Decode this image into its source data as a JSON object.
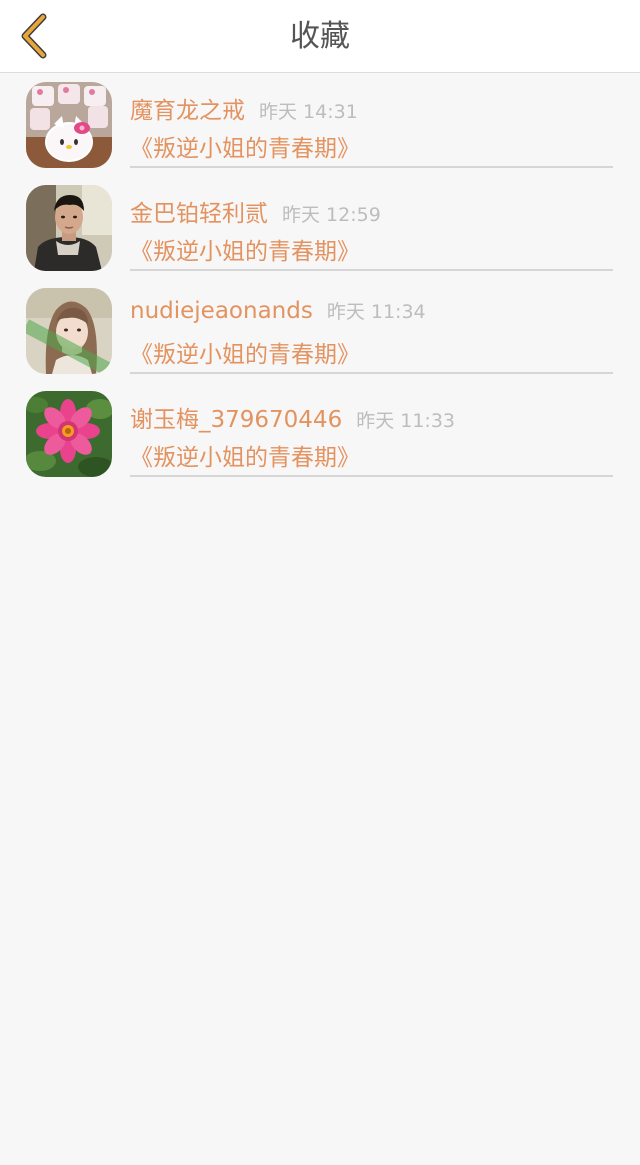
{
  "header": {
    "title": "收藏",
    "back_icon": "chevron-left-icon",
    "back_icon_color": "#e8a63a"
  },
  "items": [
    {
      "name": "魔育龙之戒",
      "time": "昨天 14:31",
      "book": "《叛逆小姐的青春期》",
      "avatar": "hello-kitty-mugs"
    },
    {
      "name": "金巴铂轻利贰",
      "time": "昨天 12:59",
      "book": "《叛逆小姐的青春期》",
      "avatar": "man-portrait"
    },
    {
      "name": "nudiejeaonands",
      "time": "昨天 11:34",
      "book": "《叛逆小姐的青春期》",
      "avatar": "girl-portrait"
    },
    {
      "name": "谢玉梅_379670446",
      "time": "昨天 11:33",
      "book": "《叛逆小姐的青春期》",
      "avatar": "pink-flower"
    }
  ],
  "colors": {
    "accent": "#e3935f",
    "muted": "#bdbdbd",
    "background": "#f8f7f8"
  }
}
